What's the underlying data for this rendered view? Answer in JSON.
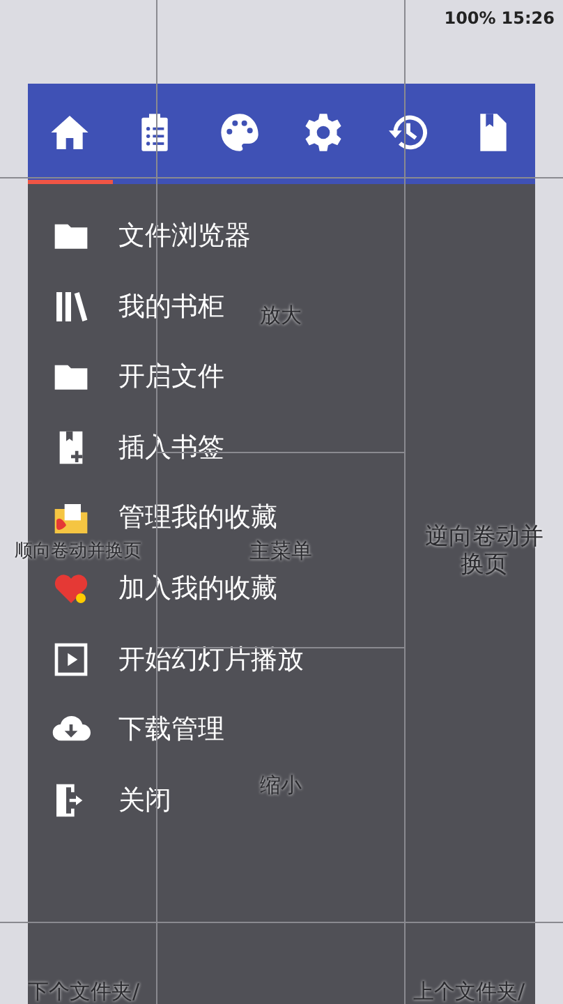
{
  "status_bar": {
    "battery": "100%",
    "time": "15:26"
  },
  "tap_zones": {
    "left": [
      "顺向卷动并换页",
      "下个文件夹/"
    ],
    "center": [
      "放大",
      "主菜单",
      "缩小"
    ],
    "right": [
      "逆向卷动并换页",
      "上个文件夹/"
    ]
  },
  "tabs": [
    {
      "selected": true
    },
    {
      "selected": false
    },
    {
      "selected": false
    },
    {
      "selected": false
    },
    {
      "selected": false
    },
    {
      "selected": false
    }
  ],
  "menu": {
    "items": [
      {
        "label": "文件浏览器"
      },
      {
        "label": "我的书柜"
      },
      {
        "label": "开启文件"
      },
      {
        "label": "插入书签"
      },
      {
        "label": "管理我的收藏"
      },
      {
        "label": "加入我的收藏"
      },
      {
        "label": "开始幻灯片播放"
      },
      {
        "label": "下载管理"
      },
      {
        "label": "关闭"
      }
    ]
  }
}
